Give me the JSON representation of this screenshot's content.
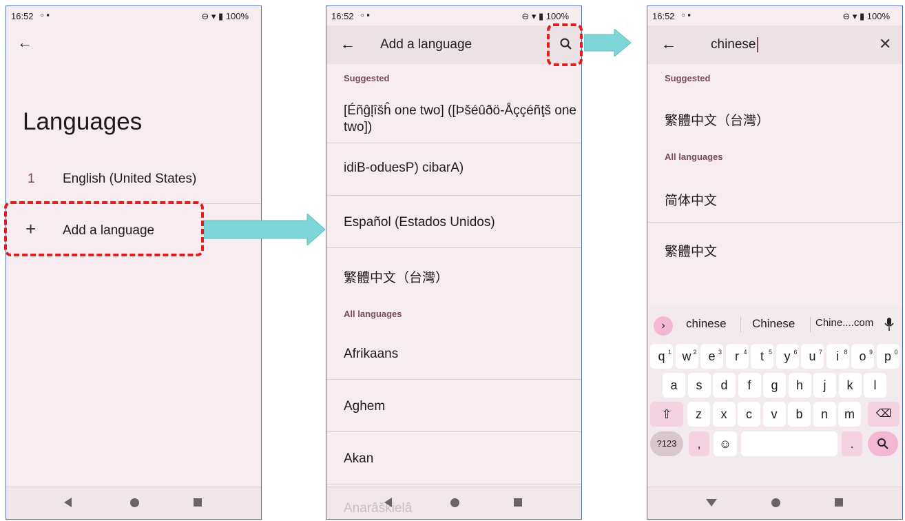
{
  "status": {
    "time": "16:52",
    "battery": "100%"
  },
  "screen1": {
    "title": "Languages",
    "languages": [
      {
        "num": "1",
        "name": "English (United States)"
      }
    ],
    "add_label": "Add a language"
  },
  "screen2": {
    "title": "Add a language",
    "suggested_label": "Suggested",
    "suggested": [
      "[Éñĝļîšĥ one two] ([Þšéûðö-Åççéñţš one two])",
      "idiB-oduesP) cibarA)",
      "Español (Estados Unidos)",
      "繁體中文（台灣）"
    ],
    "all_label": "All languages",
    "all": [
      "Afrikaans",
      "Aghem",
      "Akan",
      "Anarâškielâ"
    ]
  },
  "screen3": {
    "search_value": "chinese",
    "suggested_label": "Suggested",
    "suggested": [
      "繁體中文（台灣）"
    ],
    "all_label": "All languages",
    "all": [
      "简体中文",
      "繁體中文"
    ],
    "keyboard": {
      "suggestions": [
        "chinese",
        "Chinese",
        "Chine....com"
      ],
      "row1": [
        "q",
        "w",
        "e",
        "r",
        "t",
        "y",
        "u",
        "i",
        "o",
        "p"
      ],
      "row1_hints": [
        "1",
        "2",
        "3",
        "4",
        "5",
        "6",
        "7",
        "8",
        "9",
        "0"
      ],
      "row2": [
        "a",
        "s",
        "d",
        "f",
        "g",
        "h",
        "j",
        "k",
        "l"
      ],
      "row3": [
        "z",
        "x",
        "c",
        "v",
        "b",
        "n",
        "m"
      ],
      "symbols": "?123",
      "comma": ",",
      "period": "."
    }
  },
  "colors": {
    "accent": "#e01e1e",
    "arrow": "#7fd6d8",
    "phone_bg": "#f7ecef"
  }
}
